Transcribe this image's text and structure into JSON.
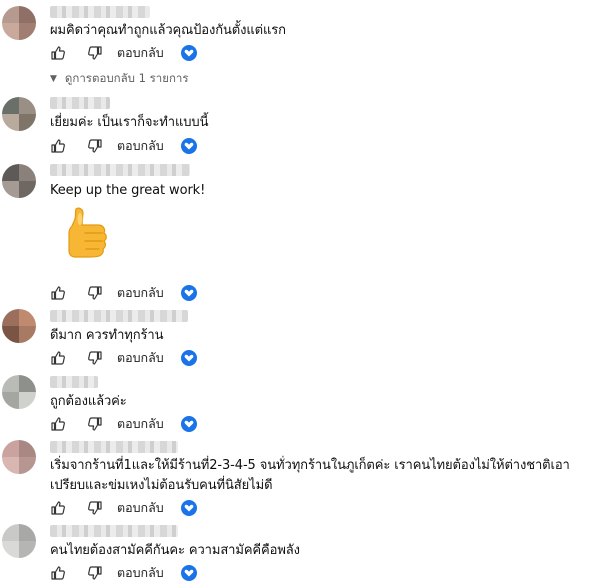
{
  "comments": [
    {
      "text": "ผมคิดว่าคุณทำถูกแล้วคุณป้องกันตั้งแต่แรก",
      "reply_label": "ตอบกลับ",
      "replies_toggle": "ดูการตอบกลับ 1 รายการ"
    },
    {
      "text": "เยี่ยมค่ะ เป็นเราก็จะทำแบบนี้",
      "reply_label": "ตอบกลับ"
    },
    {
      "text": "Keep up the great work!",
      "reply_label": "ตอบกลับ"
    },
    {
      "text": "ดีมาก ควรทำทุกร้าน",
      "reply_label": "ตอบกลับ"
    },
    {
      "text": "ถูกต้องแล้วค่ะ",
      "reply_label": "ตอบกลับ"
    },
    {
      "text": "เริ่มจากร้านที่1และให้มีร้านที่2-3-4-5 จนทั่วทุกร้านในภูเก็ตค่ะ เราคนไทยต้องไม่ให้ต่างชาติเอา",
      "text2": "เปรียบและข่มเหงไม่ต้อนรับคนที่นิสัยไม่ดี",
      "reply_label": "ตอบกลับ"
    },
    {
      "text": "คนไทยต้องสามัคคีกันคะ ความสามัคคีคือพลัง",
      "reply_label": "ตอบกลับ"
    }
  ],
  "colors": {
    "accent": "#1a73e8",
    "secondary_text": "#606060"
  },
  "icons": {
    "like": "thumbs-up-icon",
    "dislike": "thumbs-down-icon",
    "creator": "creator-heart-icon",
    "emoji": "thumbs-up-emoji"
  }
}
